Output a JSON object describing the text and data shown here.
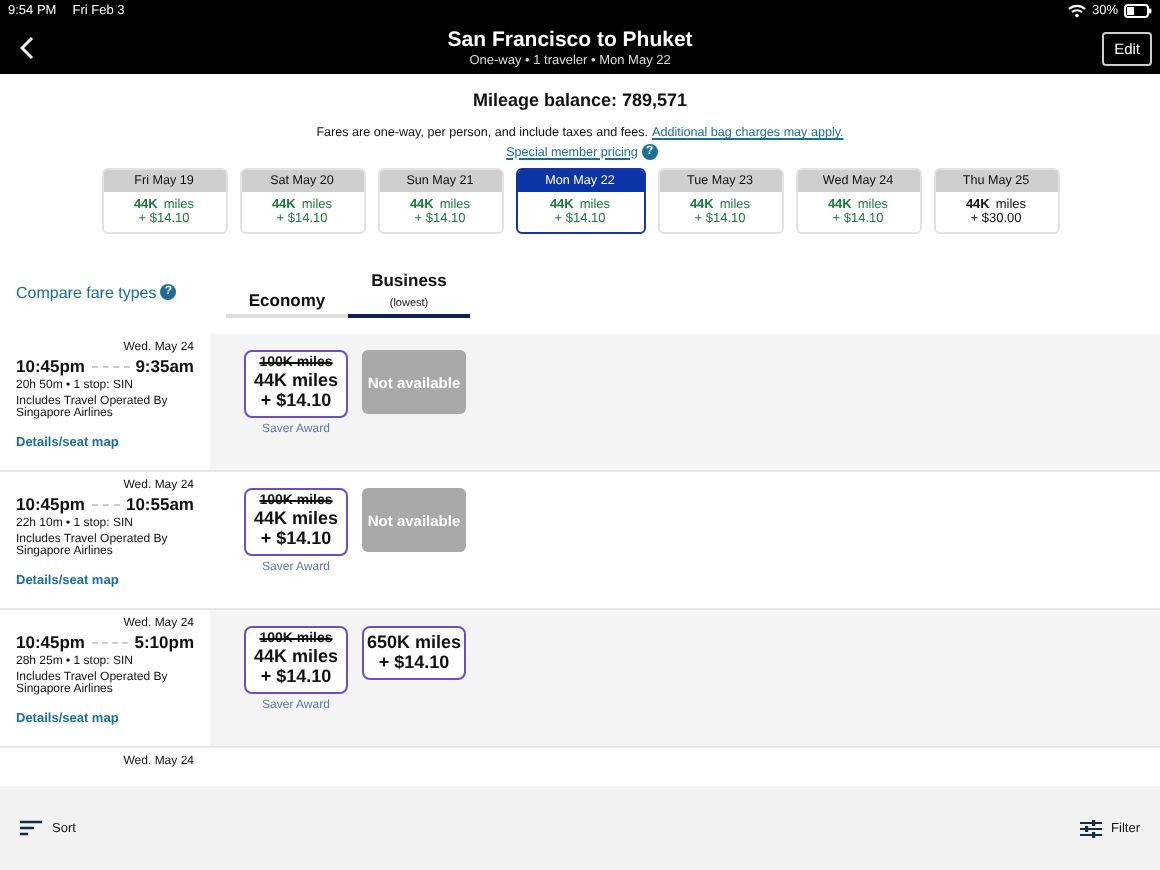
{
  "status_bar": {
    "time": "9:54 PM",
    "date": "Fri Feb 3",
    "battery": "30%"
  },
  "header": {
    "title": "San Francisco to Phuket",
    "subtitle": "One-way • 1 traveler • Mon May 22",
    "edit": "Edit"
  },
  "mileage_balance": "Mileage balance: 789,571",
  "notice": {
    "text": "Fares are one-way, per person, and include taxes and fees.",
    "link": "Additional bag charges may apply.",
    "special_pricing": "Special member pricing",
    "help": "?"
  },
  "dates": [
    {
      "day": "Fri May 19",
      "miles": "44K",
      "unit": "miles",
      "fee": "+ $14.10",
      "saver": true,
      "selected": false
    },
    {
      "day": "Sat May 20",
      "miles": "44K",
      "unit": "miles",
      "fee": "+ $14.10",
      "saver": true,
      "selected": false
    },
    {
      "day": "Sun May 21",
      "miles": "44K",
      "unit": "miles",
      "fee": "+ $14.10",
      "saver": true,
      "selected": false
    },
    {
      "day": "Mon May 22",
      "miles": "44K",
      "unit": "miles",
      "fee": "+ $14.10",
      "saver": true,
      "selected": true
    },
    {
      "day": "Tue May 23",
      "miles": "44K",
      "unit": "miles",
      "fee": "+ $14.10",
      "saver": true,
      "selected": false
    },
    {
      "day": "Wed May 24",
      "miles": "44K",
      "unit": "miles",
      "fee": "+ $14.10",
      "saver": true,
      "selected": false
    },
    {
      "day": "Thu May 25",
      "miles": "44K",
      "unit": "miles",
      "fee": "+ $30.00",
      "saver": false,
      "selected": false
    }
  ],
  "compare_fare_types": {
    "label": "Compare fare types",
    "help": "?"
  },
  "cabin_tabs": [
    {
      "label": "Economy",
      "selected": false
    },
    {
      "label": "Business",
      "sublabel": "(lowest)",
      "selected": true
    }
  ],
  "flights": [
    {
      "date": "Wed. May 24",
      "depart": "10:45pm",
      "arrive": "9:35am",
      "duration": "20h 50m • 1 stop: SIN",
      "operator": "Includes Travel Operated By Singapore Airlines",
      "details": "Details/seat map",
      "fares": [
        {
          "kind": "award",
          "original": "100K miles",
          "miles": "44K miles",
          "fee": "+ $14.10",
          "award_label": "Saver Award"
        },
        {
          "kind": "unavailable",
          "label": "Not available"
        }
      ]
    },
    {
      "date": "Wed. May 24",
      "depart": "10:45pm",
      "arrive": "10:55am",
      "duration": "22h 10m • 1 stop: SIN",
      "operator": "Includes Travel Operated By Singapore Airlines",
      "details": "Details/seat map",
      "fares": [
        {
          "kind": "award",
          "original": "100K miles",
          "miles": "44K miles",
          "fee": "+ $14.10",
          "award_label": "Saver Award"
        },
        {
          "kind": "unavailable",
          "label": "Not available"
        }
      ]
    },
    {
      "date": "Wed. May 24",
      "depart": "10:45pm",
      "arrive": "5:10pm",
      "duration": "28h 25m • 1 stop: SIN",
      "operator": "Includes Travel Operated By Singapore Airlines",
      "details": "Details/seat map",
      "fares": [
        {
          "kind": "award",
          "original": "100K miles",
          "miles": "44K miles",
          "fee": "+ $14.10",
          "award_label": "Saver Award"
        },
        {
          "kind": "award",
          "miles": "650K miles",
          "fee": "+ $14.10"
        }
      ]
    },
    {
      "date": "Wed. May 24"
    }
  ],
  "bottom_bar": {
    "sort": "Sort",
    "filter": "Filter"
  }
}
